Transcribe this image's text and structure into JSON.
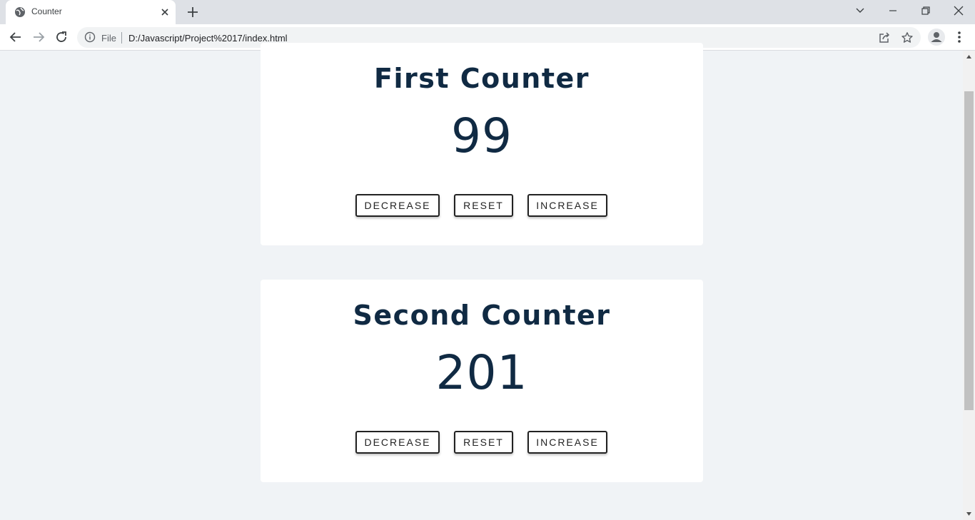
{
  "browser": {
    "tab": {
      "title": "Counter",
      "favicon": "globe-icon"
    },
    "address": {
      "scheme_label": "File",
      "url": "D:/Javascript/Project%2017/index.html"
    }
  },
  "counters": [
    {
      "title": "First Counter",
      "value": "99",
      "decrease_label": "DECREASE",
      "reset_label": "RESET",
      "increase_label": "INCREASE"
    },
    {
      "title": "Second Counter",
      "value": "201",
      "decrease_label": "DECREASE",
      "reset_label": "RESET",
      "increase_label": "INCREASE"
    }
  ],
  "colors": {
    "page_bg": "#f0f3f6",
    "card_bg": "#ffffff",
    "text": "#102a43",
    "button_border": "#222222"
  }
}
